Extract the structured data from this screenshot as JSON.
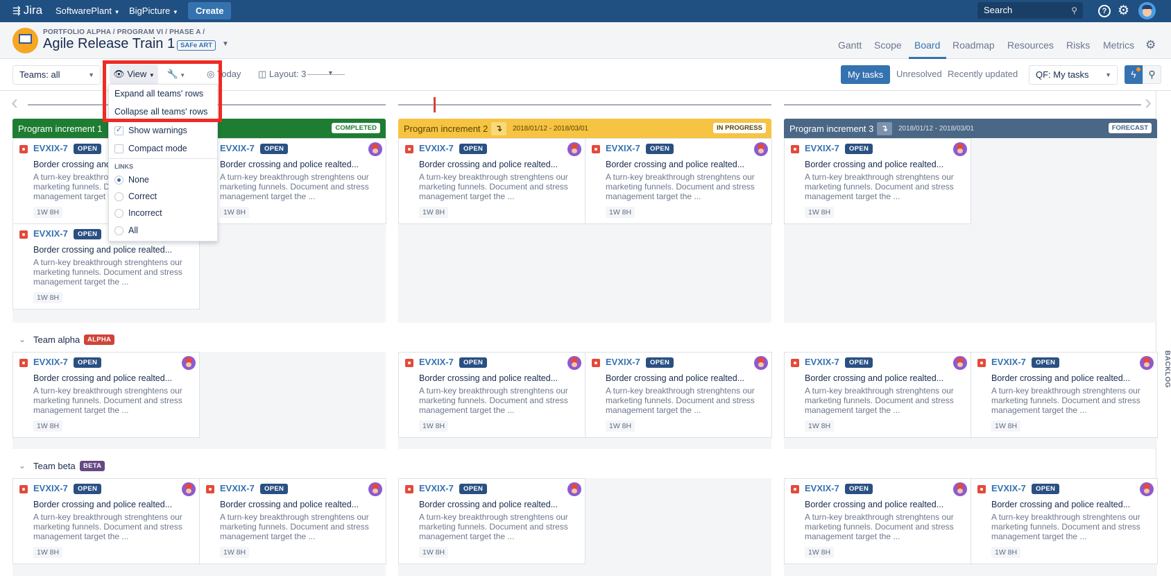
{
  "topbar": {
    "logo": "Jira",
    "menus": [
      "SoftwarePlant",
      "BigPicture"
    ],
    "create": "Create",
    "search_placeholder": "Search",
    "help": "?",
    "settings": "⚙"
  },
  "header": {
    "breadcrumb": "PORTFOLIO ALPHA / PROGRAM VI / PHASE A /",
    "title": "Agile Release Train 1",
    "badge": "SAFe ART",
    "tabs": [
      "Gantt",
      "Scope",
      "Board",
      "Roadmap",
      "Resources",
      "Risks",
      "Metrics"
    ],
    "active_tab": "Board"
  },
  "toolbar": {
    "teams_select": "Teams: all",
    "view": "View",
    "today": "Today",
    "layout": "Layout: 3",
    "quick_filters": [
      "My tasks",
      "Unresolved",
      "Recently updated"
    ],
    "active_filter": "My tasks",
    "qf_select": "QF: My tasks"
  },
  "view_menu": {
    "expand": "Expand all teams' rows",
    "collapse": "Collapse all teams' rows",
    "show_warnings": {
      "label": "Show warnings",
      "checked": true
    },
    "compact_mode": {
      "label": "Compact mode",
      "checked": false
    },
    "links_header": "LINKS",
    "links": [
      "None",
      "Correct",
      "Incorrect",
      "All"
    ],
    "links_selected": "None"
  },
  "increments": [
    {
      "name": "Program increment 1",
      "dates": "",
      "status": "COMPLETED",
      "color": "#1e7d32",
      "status_color": "#1e7d32"
    },
    {
      "name": "Program increment 2",
      "dates": "2018/01/12 - 2018/03/01",
      "status": "IN PROGRESS",
      "color": "#f6c342",
      "status_color": "#594300"
    },
    {
      "name": "Program increment 3",
      "dates": "2018/01/12 - 2018/03/01",
      "status": "FORECAST",
      "color": "#4a6785",
      "status_color": "#4a6785"
    }
  ],
  "teams": [
    {
      "name": "Team alpha",
      "badge": "ALPHA",
      "color": "#d04437"
    },
    {
      "name": "Team beta",
      "badge": "BETA",
      "color": "#654982"
    }
  ],
  "card": {
    "key": "EVXIX-7",
    "status": "OPEN",
    "summary": "Border crossing and police realted...",
    "description": "A turn-key breakthrough strenghtens our marketing funnels. Document and stress management target the ...",
    "estimate": "1W 8H"
  },
  "backlog": "BACKLOG"
}
